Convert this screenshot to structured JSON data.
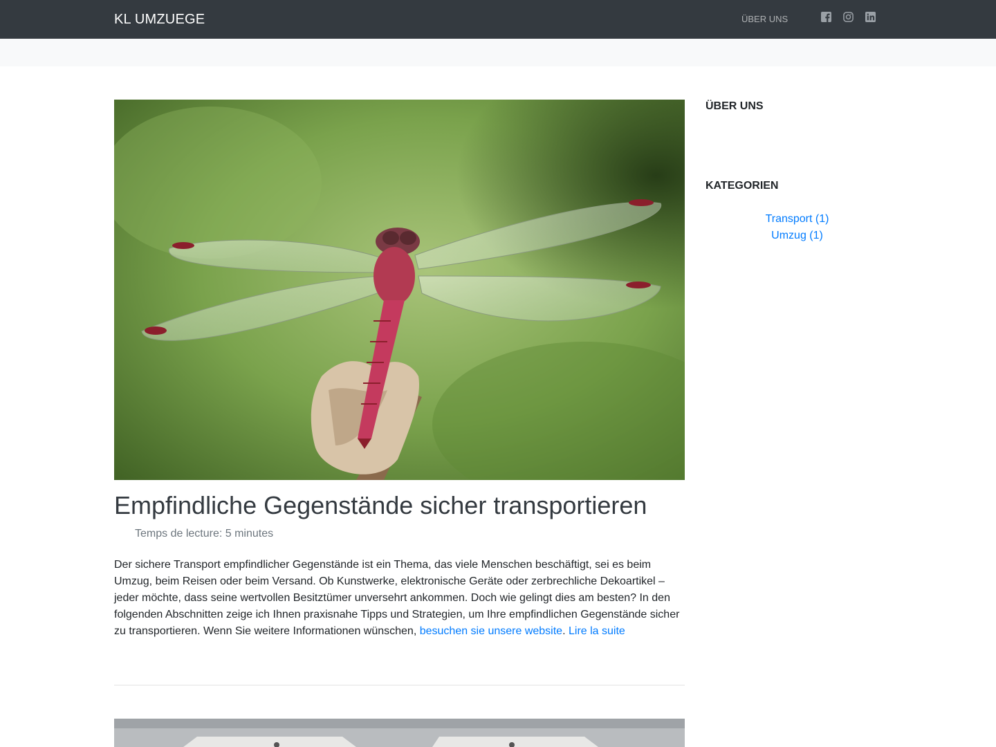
{
  "header": {
    "brand": "KL UMZUEGE",
    "nav": [
      {
        "label": "ÜBER UNS"
      }
    ],
    "social_icons": [
      "facebook-icon",
      "instagram-icon",
      "linkedin-icon"
    ]
  },
  "post": {
    "image_alt_subject": "dragonfly-photo",
    "title": "Empfindliche Gegenstände sicher transportieren",
    "reading_time": "Temps de lecture: 5 minutes",
    "excerpt_text": "Der sichere Transport empfindlicher Gegenstände ist ein Thema, das viele Menschen beschäftigt, sei es beim Umzug, beim Reisen oder beim Versand. Ob Kunstwerke, elektronische Geräte oder zerbrechliche Dekoartikel – jeder möchte, dass seine wertvollen Besitztümer unversehrt ankommen. Doch wie gelingt dies am besten? In den folgenden Abschnitten zeige ich Ihnen praxisnahe Tipps und Strategien, um Ihre empfindlichen Gegenstände sicher zu transportieren. Wenn Sie weitere Informationen wünschen, ",
    "excerpt_link": "besuchen sie unsere website",
    "excerpt_period": ".",
    "read_more": "Lire la suite"
  },
  "sidebar": {
    "about_heading": "ÜBER UNS",
    "categories_heading": "KATEGORIEN",
    "categories": [
      {
        "label": "Transport (1)"
      },
      {
        "label": "Umzug (1)"
      }
    ]
  },
  "colors": {
    "navbar": "#343a40",
    "subbar": "#f8f9fa",
    "link": "#007bff",
    "title": "#343a40",
    "muted": "#6c757d"
  }
}
